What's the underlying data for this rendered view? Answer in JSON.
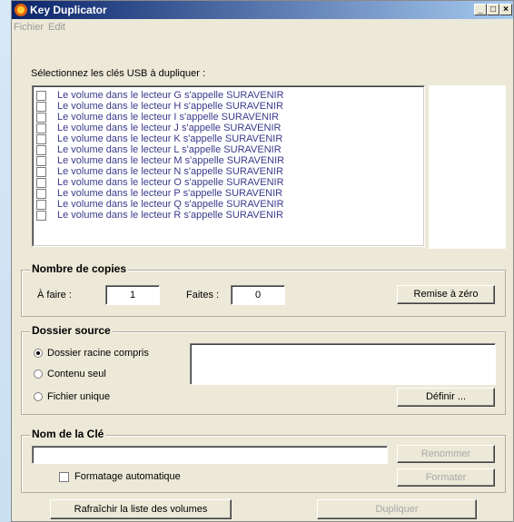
{
  "window": {
    "title": "Key Duplicator",
    "minimize": "_",
    "maximize": "□",
    "close": "×"
  },
  "menu": {
    "items": [
      "Fichier",
      "Edit"
    ]
  },
  "usb": {
    "prompt": "Sélectionnez les clés USB à dupliquer :",
    "volumes": [
      "Le volume dans le lecteur G s'appelle SURAVENIR",
      "Le volume dans le lecteur H s'appelle SURAVENIR",
      "Le volume dans le lecteur I s'appelle SURAVENIR",
      "Le volume dans le lecteur J s'appelle SURAVENIR",
      "Le volume dans le lecteur K s'appelle SURAVENIR",
      "Le volume dans le lecteur L s'appelle SURAVENIR",
      "Le volume dans le lecteur M s'appelle SURAVENIR",
      "Le volume dans le lecteur N s'appelle SURAVENIR",
      "Le volume dans le lecteur O s'appelle SURAVENIR",
      "Le volume dans le lecteur P s'appelle SURAVENIR",
      "Le volume dans le lecteur Q s'appelle SURAVENIR",
      "Le volume dans le lecteur R s'appelle SURAVENIR"
    ],
    "volume_text_color": "#3a3a8c"
  },
  "copies": {
    "title": "Nombre de copies",
    "todo_label": "À faire :",
    "todo_value": "1",
    "done_label": "Faites :",
    "done_value": "0",
    "reset_button": "Remise à zéro"
  },
  "source": {
    "title": "Dossier source",
    "options": [
      "Dossier racine compris",
      "Contenu seul",
      "Fichier unique"
    ],
    "selected": "Dossier racine compris",
    "define_button": "Définir ..."
  },
  "keyname": {
    "title": "Nom de la Clé",
    "value": "",
    "rename_button": "Renommer",
    "autoformat_label": "Formatage automatique",
    "format_button": "Formater"
  },
  "footer": {
    "refresh_button": "Rafraîchir la liste des volumes",
    "duplicate_button": "Dupliquer"
  }
}
